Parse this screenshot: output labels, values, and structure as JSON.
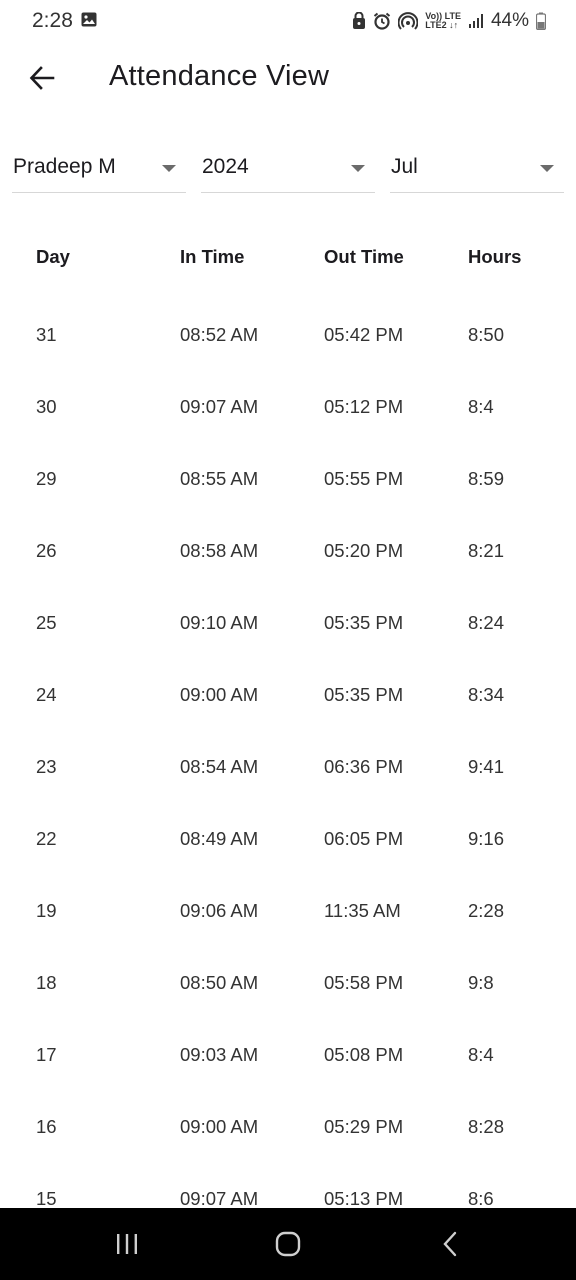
{
  "status_bar": {
    "time": "2:28",
    "network_top": "Vo)) LTE",
    "network_bottom": "LTE2 ↓↑",
    "battery": "44%"
  },
  "app_bar": {
    "title": "Attendance View",
    "back_icon": "arrow-left-icon"
  },
  "filters": {
    "employee": "Pradeep M",
    "year": "2024",
    "month": "Jul"
  },
  "table": {
    "headers": [
      "Day",
      "In Time",
      "Out Time",
      "Hours"
    ],
    "rows": [
      [
        "31",
        "08:52 AM",
        "05:42 PM",
        "8:50"
      ],
      [
        "30",
        "09:07 AM",
        "05:12 PM",
        "8:4"
      ],
      [
        "29",
        "08:55 AM",
        "05:55 PM",
        "8:59"
      ],
      [
        "26",
        "08:58 AM",
        "05:20 PM",
        "8:21"
      ],
      [
        "25",
        "09:10 AM",
        "05:35 PM",
        "8:24"
      ],
      [
        "24",
        "09:00 AM",
        "05:35 PM",
        "8:34"
      ],
      [
        "23",
        "08:54 AM",
        "06:36 PM",
        "9:41"
      ],
      [
        "22",
        "08:49 AM",
        "06:05 PM",
        "9:16"
      ],
      [
        "19",
        "09:06 AM",
        "11:35 AM",
        "2:28"
      ],
      [
        "18",
        "08:50 AM",
        "05:58 PM",
        "9:8"
      ],
      [
        "17",
        "09:03 AM",
        "05:08 PM",
        "8:4"
      ],
      [
        "16",
        "09:00 AM",
        "05:29 PM",
        "8:28"
      ],
      [
        "15",
        "09:07 AM",
        "05:13 PM",
        "8:6"
      ]
    ]
  },
  "nav_bar": {
    "recents_icon": "recents-icon",
    "home_icon": "home-icon",
    "back_icon": "back-chevron-icon"
  }
}
